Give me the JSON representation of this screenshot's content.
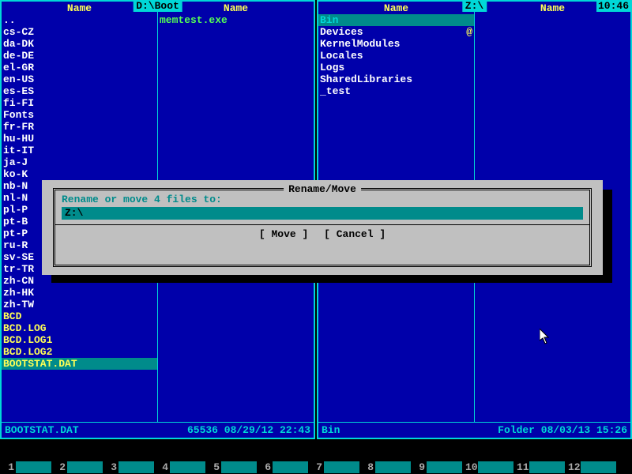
{
  "clock": "10:46",
  "left_panel": {
    "path": "D:\\Boot",
    "headers": [
      "Name",
      "Name"
    ],
    "col1": [
      {
        "n": "..",
        "cls": "folder"
      },
      {
        "n": "cs-CZ",
        "cls": "folder"
      },
      {
        "n": "da-DK",
        "cls": "folder"
      },
      {
        "n": "de-DE",
        "cls": "folder"
      },
      {
        "n": "el-GR",
        "cls": "folder"
      },
      {
        "n": "en-US",
        "cls": "folder"
      },
      {
        "n": "es-ES",
        "cls": "folder"
      },
      {
        "n": "fi-FI",
        "cls": "folder"
      },
      {
        "n": "Fonts",
        "cls": "folder"
      },
      {
        "n": "fr-FR",
        "cls": "folder"
      },
      {
        "n": "hu-HU",
        "cls": "folder"
      },
      {
        "n": "it-IT",
        "cls": "folder"
      },
      {
        "n": "ja-JP",
        "cls": "folder",
        "cut": "ja-J"
      },
      {
        "n": "ko-KR",
        "cls": "folder",
        "cut": "ko-K"
      },
      {
        "n": "nb-NO",
        "cls": "folder",
        "cut": "nb-N"
      },
      {
        "n": "nl-NL",
        "cls": "folder",
        "cut": "nl-N"
      },
      {
        "n": "pl-PL",
        "cls": "folder",
        "cut": "pl-P"
      },
      {
        "n": "pt-BR",
        "cls": "folder",
        "cut": "pt-B"
      },
      {
        "n": "pt-PT",
        "cls": "folder",
        "cut": "pt-P"
      },
      {
        "n": "ru-RU",
        "cls": "folder",
        "cut": "ru-R"
      },
      {
        "n": "sv-SE",
        "cls": "folder"
      },
      {
        "n": "tr-TR",
        "cls": "folder"
      },
      {
        "n": "zh-CN",
        "cls": "folder"
      },
      {
        "n": "zh-HK",
        "cls": "folder"
      },
      {
        "n": "zh-TW",
        "cls": "folder"
      },
      {
        "n": "BCD",
        "cls": "yellow"
      },
      {
        "n": "BCD.LOG",
        "cls": "yellow"
      },
      {
        "n": "BCD.LOG1",
        "cls": "yellow"
      },
      {
        "n": "BCD.LOG2",
        "cls": "yellow"
      },
      {
        "n": "BOOTSTAT.DAT",
        "cls": "selected"
      }
    ],
    "col2": [
      {
        "n": "memtest.exe",
        "cls": "exe"
      }
    ],
    "status": {
      "name": "BOOTSTAT.DAT",
      "info": "65536 08/29/12 22:43"
    }
  },
  "right_panel": {
    "path": "Z:\\",
    "headers": [
      "Name",
      "Name"
    ],
    "col1": [
      {
        "n": "Bin",
        "cls": "folder"
      },
      {
        "n": "Devices",
        "cls": "folder",
        "mark": "@"
      },
      {
        "n": "KernelModules",
        "cls": "folder"
      },
      {
        "n": "Locales",
        "cls": "folder"
      },
      {
        "n": "Logs",
        "cls": "folder"
      },
      {
        "n": "SharedLibraries",
        "cls": "folder"
      },
      {
        "n": "_test",
        "cls": "folder"
      }
    ],
    "col2": [],
    "status": {
      "name": "Bin",
      "info": "Folder 08/03/13 15:26"
    }
  },
  "dialog": {
    "title": " Rename/Move ",
    "prompt": "Rename or move 4 files to:",
    "input_value": "Z:\\",
    "btn_move": "[ Move ]",
    "btn_cancel": "[ Cancel ]"
  },
  "fkeys": [
    "1",
    "2",
    "3",
    "4",
    "5",
    "6",
    "7",
    "8",
    "9",
    "10",
    "11",
    "12"
  ]
}
